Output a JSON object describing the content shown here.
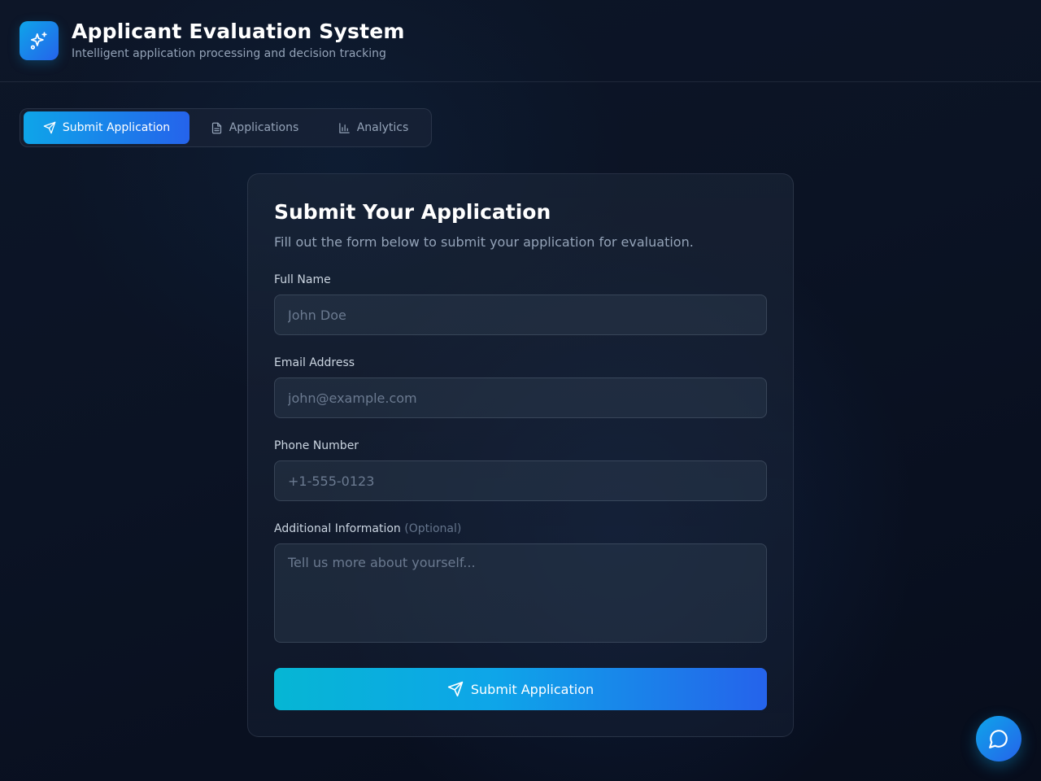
{
  "header": {
    "title": "Applicant Evaluation System",
    "subtitle": "Intelligent application processing and decision tracking",
    "logo_icon": "sparkles-icon"
  },
  "tabs": [
    {
      "label": "Submit Application",
      "icon": "send-icon",
      "active": true
    },
    {
      "label": "Applications",
      "icon": "document-icon",
      "active": false
    },
    {
      "label": "Analytics",
      "icon": "bar-chart-icon",
      "active": false
    }
  ],
  "form": {
    "title": "Submit Your Application",
    "description": "Fill out the form below to submit your application for evaluation.",
    "fields": {
      "full_name": {
        "label": "Full Name",
        "placeholder": "John Doe",
        "value": ""
      },
      "email": {
        "label": "Email Address",
        "placeholder": "john@example.com",
        "value": ""
      },
      "phone": {
        "label": "Phone Number",
        "placeholder": "+1-555-0123",
        "value": ""
      },
      "additional": {
        "label": "Additional Information",
        "optional_tag": "(Optional)",
        "placeholder": "Tell us more about yourself...",
        "value": ""
      }
    },
    "submit_label": "Submit Application"
  },
  "chat": {
    "icon": "chat-bubble-icon"
  },
  "colors": {
    "accent_start": "#0ea5e9",
    "accent_end": "#2563eb",
    "background": "#0b1324"
  }
}
